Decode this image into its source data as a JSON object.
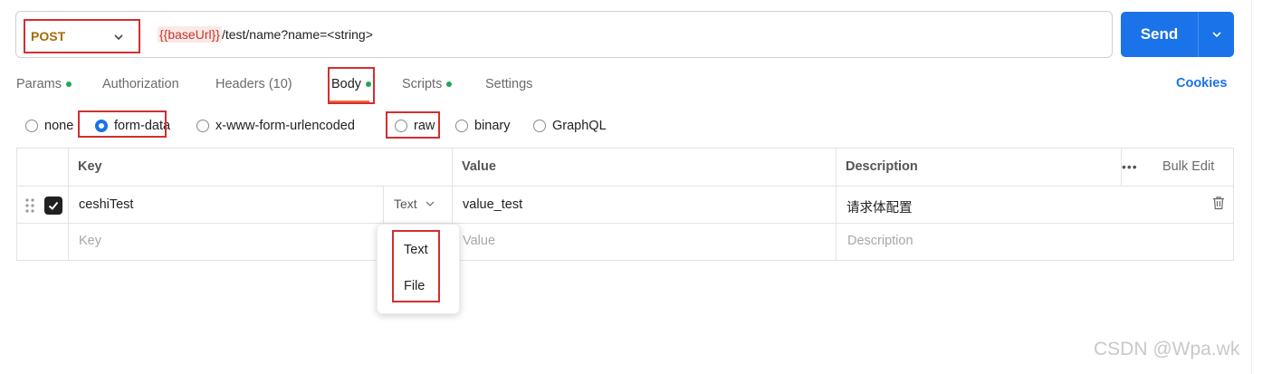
{
  "request": {
    "method": "POST",
    "url_variable": "{{baseUrl}}",
    "url_path": "/test/name?name=<string>"
  },
  "send": {
    "label": "Send",
    "dropdown_icon": "chevron-down-icon"
  },
  "tabs": [
    {
      "label": "Params",
      "dot": true
    },
    {
      "label": "Authorization",
      "dot": false
    },
    {
      "label": "Headers (10)",
      "dot": false
    },
    {
      "label": "Body",
      "dot": true,
      "active": true
    },
    {
      "label": "Scripts",
      "dot": true
    },
    {
      "label": "Settings",
      "dot": false
    }
  ],
  "cookies_label": "Cookies",
  "body_types": [
    {
      "label": "none",
      "selected": false
    },
    {
      "label": "form-data",
      "selected": true
    },
    {
      "label": "x-www-form-urlencoded",
      "selected": false
    },
    {
      "label": "raw",
      "selected": false
    },
    {
      "label": "binary",
      "selected": false
    },
    {
      "label": "GraphQL",
      "selected": false
    }
  ],
  "table": {
    "headers": {
      "key": "Key",
      "value": "Value",
      "description": "Description",
      "bulk_edit": "Bulk Edit",
      "more": "•••"
    },
    "rows": [
      {
        "checked": true,
        "key": "ceshiTest",
        "type": "Text",
        "value": "value_test",
        "description": "请求体配置"
      }
    ],
    "placeholders": {
      "key": "Key",
      "value": "Value",
      "description": "Description"
    }
  },
  "type_dropdown": {
    "options": [
      "Text",
      "File"
    ]
  },
  "watermark": "CSDN @Wpa.wk",
  "colors": {
    "accent": "#1a73e8",
    "method": "#a86b00",
    "highlight_box": "#d32f2f",
    "status_dot": "#1fa855",
    "active_tab_underline": "#f26b3a"
  }
}
